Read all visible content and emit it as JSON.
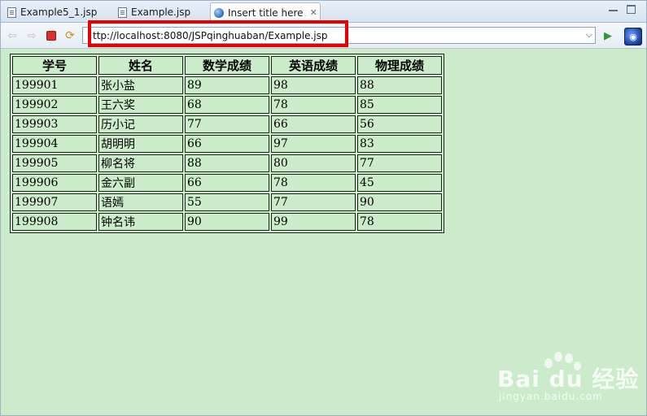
{
  "tabs": [
    {
      "label": "Example5_1.jsp"
    },
    {
      "label": "Example.jsp"
    },
    {
      "label": "Insert title here",
      "close": "✕"
    }
  ],
  "toolbar": {
    "url": "ttp://localhost:8080/JSPqinghuaban/Example.jsp",
    "dropdown": "⌵"
  },
  "table": {
    "headers": [
      "学号",
      "姓名",
      "数学成绩",
      "英语成绩",
      "物理成绩"
    ],
    "rows": [
      [
        "199901",
        "张小盐",
        "89",
        "98",
        "88"
      ],
      [
        "199902",
        "王六奖",
        "68",
        "78",
        "85"
      ],
      [
        "199903",
        "历小记",
        "77",
        "66",
        "56"
      ],
      [
        "199904",
        "胡明明",
        "66",
        "97",
        "83"
      ],
      [
        "199905",
        "柳名将",
        "88",
        "80",
        "77"
      ],
      [
        "199906",
        "金六副",
        "66",
        "78",
        "45"
      ],
      [
        "199907",
        "语嫣",
        "55",
        "77",
        "90"
      ],
      [
        "199908",
        "钟名讳",
        "90",
        "99",
        "78"
      ]
    ]
  },
  "watermark": {
    "brand": "Bai du 经验",
    "url": "jingyan.baidu.com"
  },
  "colors": {
    "content_bg": "#cbebcb",
    "highlight": "#e60000"
  },
  "icons": {
    "back": "arrow-left-icon",
    "forward": "arrow-right-icon",
    "stop": "stop-icon",
    "refresh": "refresh-icon",
    "go": "play-icon",
    "external": "external-browser-icon"
  }
}
